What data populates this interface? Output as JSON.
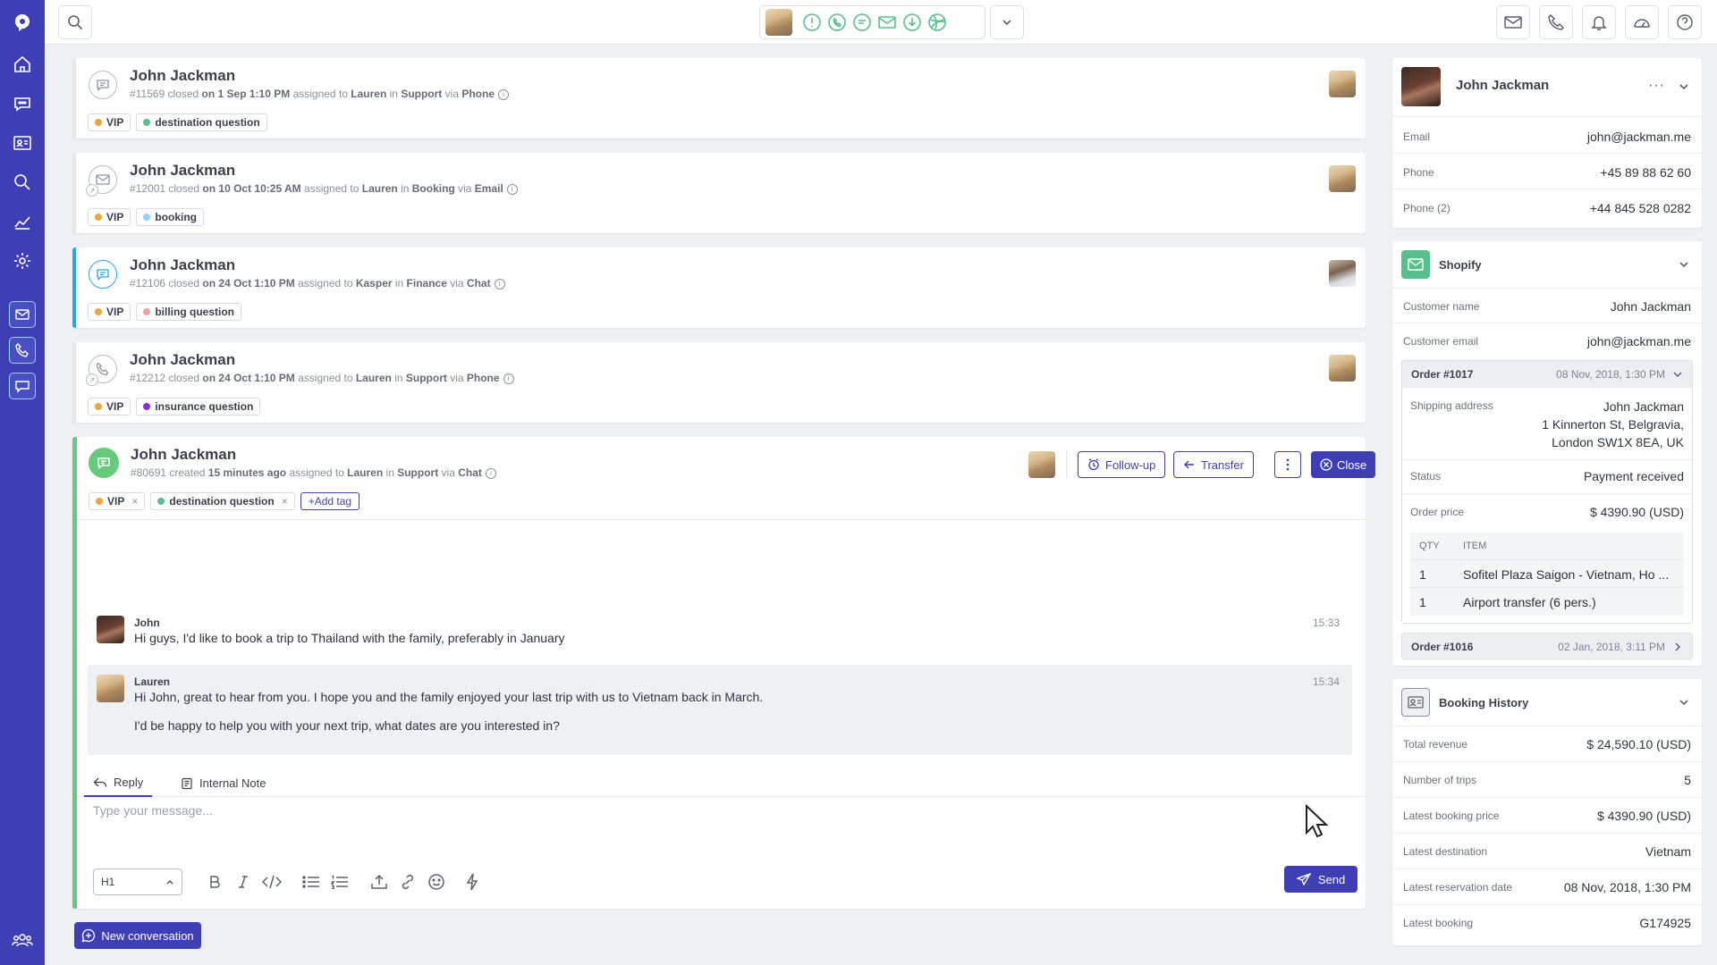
{
  "app": {
    "colors": {
      "nav": "#3f3fb5",
      "chat": "#2aa3ef",
      "active": "#67c97c",
      "vip": "#f0a53b"
    }
  },
  "nav": {
    "items": [
      "logo-icon",
      "home-icon",
      "conversations-icon",
      "contacts-icon",
      "search-icon",
      "reports-icon",
      "settings-icon",
      "email-channel-icon",
      "phone-channel-icon",
      "chat-channel-icon",
      "team-icon"
    ]
  },
  "conversations": [
    {
      "name": "John Jackman",
      "id": "#11569",
      "status": "closed",
      "date": "on 1 Sep 1:10 PM",
      "assignee": "Lauren",
      "team": "Support",
      "via": "Phone",
      "tags": [
        {
          "label": "VIP",
          "color": "#f0a53b"
        },
        {
          "label": "destination question",
          "color": "#58c08a"
        }
      ]
    },
    {
      "name": "John Jackman",
      "id": "#12001",
      "status": "closed",
      "date": "on 10 Oct 10:25 AM",
      "assignee": "Lauren",
      "team": "Booking",
      "via": "Email",
      "tags": [
        {
          "label": "VIP",
          "color": "#f0a53b"
        },
        {
          "label": "booking",
          "color": "#8fd4ff"
        }
      ]
    },
    {
      "name": "John Jackman",
      "id": "#12106",
      "status": "closed",
      "date": "on 24 Oct 1:10 PM",
      "assignee": "Kasper",
      "team": "Finance",
      "via": "Chat",
      "tags": [
        {
          "label": "VIP",
          "color": "#f0a53b"
        },
        {
          "label": "billing question",
          "color": "#f4a0a0"
        }
      ]
    },
    {
      "name": "John Jackman",
      "id": "#12212",
      "status": "closed",
      "date": "on 24 Oct 1:10 PM",
      "assignee": "Lauren",
      "team": "Support",
      "via": "Phone",
      "tags": [
        {
          "label": "VIP",
          "color": "#f0a53b"
        },
        {
          "label": "insurance question",
          "color": "#8a2be2"
        }
      ]
    }
  ],
  "current": {
    "name": "John Jackman",
    "id": "#80691",
    "status": "created",
    "date": "15 minutes ago",
    "assignee": "Lauren",
    "team": "Support",
    "via": "Chat",
    "tags": [
      {
        "label": "VIP",
        "color": "#f0a53b"
      },
      {
        "label": "destination question",
        "color": "#58c08a"
      }
    ],
    "add_tag": "+Add tag",
    "followup": "Follow-up",
    "transfer": "Transfer",
    "close": "Close",
    "messages": [
      {
        "author": "John",
        "time": "15:33",
        "lines": [
          "Hi guys, I'd like to book a trip to Thailand with the family, preferably in January"
        ]
      },
      {
        "author": "Lauren",
        "time": "15:34",
        "lines": [
          "Hi John, great to hear from you. I hope you and the family enjoyed your last trip with us to Vietnam back in March.",
          "I'd be happy to help you with your next trip, what dates are you interested in?"
        ]
      }
    ],
    "tabs": {
      "reply": "Reply",
      "note": "Internal Note"
    },
    "placeholder": "Type your message...",
    "heading_select": "H1",
    "send": "Send"
  },
  "new_conversation": "New conversation",
  "contact": {
    "name": "John Jackman",
    "email_label": "Email",
    "email": "john@jackman.me",
    "phone_label": "Phone",
    "phone": "+45 89 88 62 60",
    "phone2_label": "Phone (2)",
    "phone2": "+44 845 528 0282"
  },
  "shopify": {
    "title": "Shopify",
    "customer_name_label": "Customer name",
    "customer_name": "John Jackman",
    "customer_email_label": "Customer email",
    "customer_email": "john@jackman.me",
    "order1": {
      "number": "Order #1017",
      "date": "08 Nov, 2018, 1:30 PM",
      "shipping_label": "Shipping address",
      "shipping": [
        "John Jackman",
        "1 Kinnerton St, Belgravia,",
        "London SW1X 8EA, UK"
      ],
      "status_label": "Status",
      "status": "Payment received",
      "price_label": "Order price",
      "price": "$ 4390.90 (USD)",
      "qty_header": "QTY",
      "item_header": "ITEM",
      "items": [
        {
          "qty": "1",
          "item": "Sofitel Plaza Saigon - Vietnam, Ho ..."
        },
        {
          "qty": "1",
          "item": "Airport transfer (6 pers.)"
        }
      ]
    },
    "order2": {
      "number": "Order #1016",
      "date": "02 Jan, 2018, 3:11 PM"
    }
  },
  "booking": {
    "title": "Booking History",
    "rows": [
      {
        "label": "Total revenue",
        "value": "$ 24,590.10 (USD)"
      },
      {
        "label": "Number of trips",
        "value": "5"
      },
      {
        "label": "Latest booking price",
        "value": "$ 4390.90 (USD)"
      },
      {
        "label": "Latest destination",
        "value": "Vietnam"
      },
      {
        "label": "Latest reservation date",
        "value": "08 Nov, 2018, 1:30 PM"
      },
      {
        "label": "Latest booking",
        "value": "G174925"
      }
    ]
  }
}
